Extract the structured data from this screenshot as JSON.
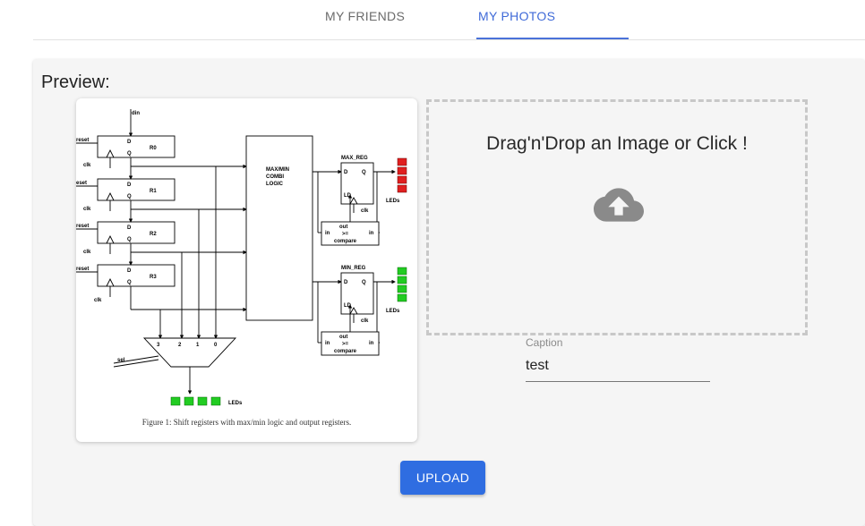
{
  "tabs": [
    {
      "label": "MY FRIENDS",
      "active": false
    },
    {
      "label": "MY PHOTOS",
      "active": true
    }
  ],
  "preview": {
    "label": "Preview:",
    "figure": {
      "caption": "Figure 1: Shift registers with max/min logic and output registers.",
      "labels": {
        "din": "din",
        "reset": "reset",
        "eset": "eset",
        "clk": "clk",
        "D": "D",
        "Q": "Q",
        "LD": "LD",
        "in": "in",
        "out": "out",
        "ge": ">=",
        "compare": "compare",
        "registers": [
          "R0",
          "R1",
          "R2",
          "R3"
        ],
        "combi": [
          "MAX/MIN",
          "COMBI",
          "LOGIC"
        ],
        "max_reg": "MAX_REG",
        "min_reg": "MIN_REG",
        "leds": "LEDs",
        "mux_inputs": [
          "3",
          "2",
          "1",
          "0"
        ],
        "sel": "sel"
      },
      "colors": {
        "max_leds": "#e02020",
        "min_leds": "#22cc22",
        "bottom_leds": "#22cc22"
      }
    }
  },
  "dropzone": {
    "text": "Drag'n'Drop an Image or Click !",
    "icon": "cloud-upload-icon"
  },
  "caption_field": {
    "label": "Caption",
    "value": "test"
  },
  "upload_button": {
    "label": "UPLOAD"
  },
  "colors": {
    "accent": "#3f6ad8",
    "button": "#2f6de1"
  }
}
